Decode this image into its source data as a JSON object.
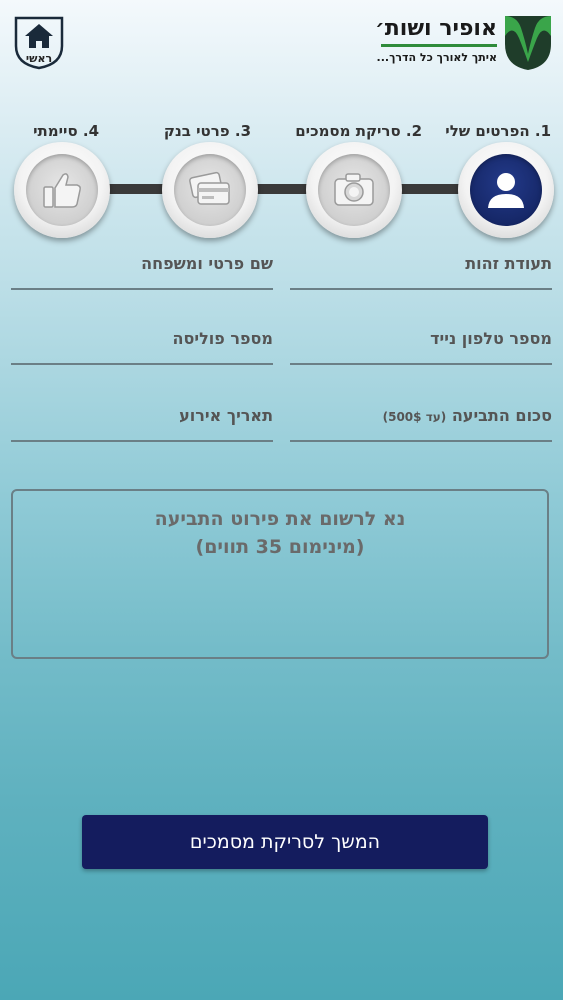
{
  "header": {
    "brand_name": "אופיר ושות׳",
    "slogan": "איתך לאורך כל הדרך...",
    "home_label": "ראשי"
  },
  "stepper": {
    "steps": [
      {
        "label": "1. הפרטים שלי",
        "icon": "user-icon",
        "active": true
      },
      {
        "label": "2. סריקת מסמכים",
        "icon": "camera-icon",
        "active": false
      },
      {
        "label": "3. פרטי בנק",
        "icon": "credit-card-icon",
        "active": false
      },
      {
        "label": "4. סיימתי",
        "icon": "thumbs-up-icon",
        "active": false
      }
    ]
  },
  "form": {
    "id_number": "תעודת זהות",
    "full_name": "שם פרטי ומשפחה",
    "mobile_phone": "מספר טלפון נייד",
    "policy_number": "מספר פוליסה",
    "claim_amount": "סכום התביעה",
    "claim_amount_hint": "(עד 500$)",
    "event_date": "תאריך אירוע",
    "claim_details_placeholder_line1": "נא לרשום את פירוט התביעה",
    "claim_details_placeholder_line2": "(מינימום 35 תווים)"
  },
  "actions": {
    "continue_label": "המשך לסריקת מסמכים"
  },
  "colors": {
    "brand_green": "#2e8b3a",
    "brand_navy": "#142563",
    "button_bg": "#141c5e"
  }
}
